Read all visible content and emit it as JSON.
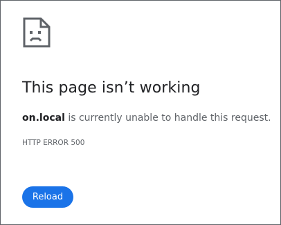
{
  "error_page": {
    "icon": "sad-page-icon",
    "heading": "This page isn’t working",
    "host": "on.local",
    "message_suffix": " is currently unable to handle this request.",
    "error_code": "HTTP ERROR 500",
    "reload_label": "Reload"
  },
  "colors": {
    "accent": "#1a73e8",
    "heading_text": "#202124",
    "body_text": "#5f6368"
  }
}
